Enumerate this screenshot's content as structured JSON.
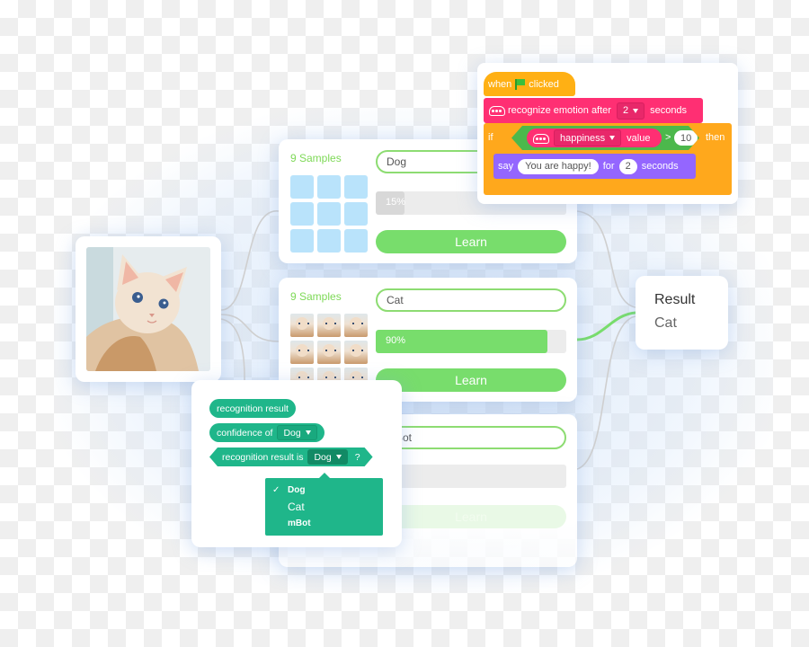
{
  "source_image": {
    "label": "Cat photo",
    "alt": "Fluffy cream kitten with blue eyes"
  },
  "classes": [
    {
      "samples_label": "9 Samples",
      "name": "Dog",
      "progress_percent": 15,
      "progress_label": "15%",
      "learn_label": "Learn",
      "sample_kind": "empty",
      "progress_color": "#d8d8d8"
    },
    {
      "samples_label": "9 Samples",
      "name": "Cat",
      "progress_percent": 90,
      "progress_label": "90%",
      "learn_label": "Learn",
      "sample_kind": "cat-photo",
      "progress_color": "#78dd6c"
    },
    {
      "samples_label": "",
      "name": "mBot",
      "progress_percent": 0,
      "progress_label": "",
      "learn_label": "Learn",
      "sample_kind": "none",
      "progress_color": "#d8d8d8"
    }
  ],
  "result": {
    "title": "Result",
    "value": "Cat"
  },
  "script": {
    "hat": {
      "when": "when",
      "clicked": "clicked"
    },
    "emotion_block": {
      "text": "recognize emotion after",
      "value": "2",
      "unit": "seconds"
    },
    "if_block": {
      "if": "if",
      "then": "then",
      "reporter_option": "happiness",
      "reporter_suffix": "value",
      "operator": ">",
      "compare_value": "10"
    },
    "say_block": {
      "say": "say",
      "message": "You are happy!",
      "for": "for",
      "duration": "2",
      "unit": "seconds"
    }
  },
  "recognition_blocks": {
    "result_reporter": "recognition result",
    "confidence": {
      "label": "confidence of",
      "value": "Dog"
    },
    "result_is": {
      "label": "recognition result is",
      "value": "Dog",
      "suffix": "?"
    },
    "dropdown_options": [
      {
        "label": "Dog",
        "checked": true
      },
      {
        "label": "Cat",
        "checked": false
      },
      {
        "label": "mBot",
        "checked": false
      }
    ],
    "check_mark": "✓"
  },
  "colors": {
    "accent_green": "#78dd6c",
    "ai_teal": "#1fb68a",
    "event_yellow": "#ffb014",
    "control_orange": "#ffa81c",
    "ai_pink": "#ff2f73",
    "looks_purple": "#9466ff",
    "operator_green": "#4cb84c"
  }
}
